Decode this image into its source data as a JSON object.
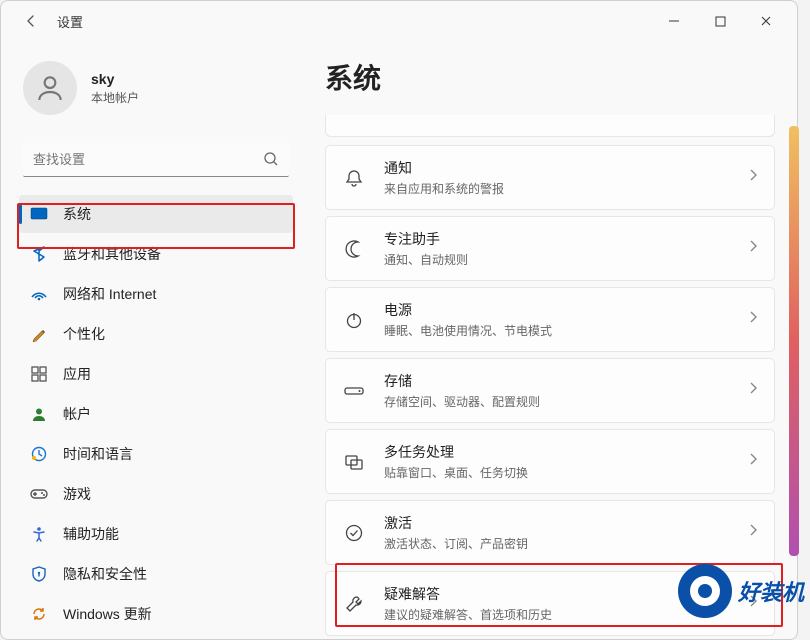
{
  "titlebar": {
    "app_title": "设置"
  },
  "account": {
    "name": "sky",
    "type": "本地帐户"
  },
  "search": {
    "placeholder": "查找设置"
  },
  "sidebar": {
    "items": [
      {
        "label": "系统",
        "icon": "system",
        "active": true
      },
      {
        "label": "蓝牙和其他设备",
        "icon": "bluetooth"
      },
      {
        "label": "网络和 Internet",
        "icon": "network"
      },
      {
        "label": "个性化",
        "icon": "personalize"
      },
      {
        "label": "应用",
        "icon": "apps"
      },
      {
        "label": "帐户",
        "icon": "accounts"
      },
      {
        "label": "时间和语言",
        "icon": "time"
      },
      {
        "label": "游戏",
        "icon": "gaming"
      },
      {
        "label": "辅助功能",
        "icon": "accessibility"
      },
      {
        "label": "隐私和安全性",
        "icon": "privacy"
      },
      {
        "label": "Windows 更新",
        "icon": "update"
      }
    ]
  },
  "main": {
    "heading": "系统",
    "cards": [
      {
        "title": "通知",
        "desc": "来自应用和系统的警报",
        "icon": "bell"
      },
      {
        "title": "专注助手",
        "desc": "通知、自动规则",
        "icon": "moon"
      },
      {
        "title": "电源",
        "desc": "睡眠、电池使用情况、节电模式",
        "icon": "power"
      },
      {
        "title": "存储",
        "desc": "存储空间、驱动器、配置规则",
        "icon": "storage"
      },
      {
        "title": "多任务处理",
        "desc": "贴靠窗口、桌面、任务切换",
        "icon": "multitask"
      },
      {
        "title": "激活",
        "desc": "激活状态、订阅、产品密钥",
        "icon": "activation"
      },
      {
        "title": "疑难解答",
        "desc": "建议的疑难解答、首选项和历史",
        "icon": "troubleshoot"
      }
    ]
  },
  "watermark": {
    "text": "好装机"
  }
}
